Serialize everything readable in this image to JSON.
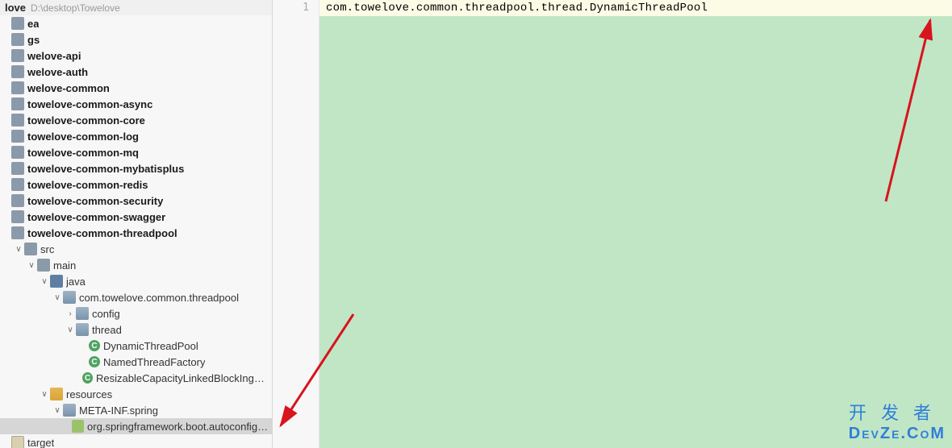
{
  "project": {
    "name": "love",
    "path": "D:\\desktop\\Towelove"
  },
  "tree": [
    {
      "indent": 0,
      "arrow": "",
      "icon": "folder",
      "label": "ea"
    },
    {
      "indent": 0,
      "arrow": "",
      "icon": "folder",
      "label": "gs"
    },
    {
      "indent": 0,
      "arrow": "",
      "icon": "folder",
      "label": "welove-api"
    },
    {
      "indent": 0,
      "arrow": "",
      "icon": "folder",
      "label": "welove-auth"
    },
    {
      "indent": 0,
      "arrow": "",
      "icon": "folder",
      "label": "welove-common"
    },
    {
      "indent": 0,
      "arrow": "",
      "icon": "folder",
      "label": "towelove-common-async"
    },
    {
      "indent": 0,
      "arrow": "",
      "icon": "folder",
      "label": "towelove-common-core"
    },
    {
      "indent": 0,
      "arrow": "",
      "icon": "folder",
      "label": "towelove-common-log"
    },
    {
      "indent": 0,
      "arrow": "",
      "icon": "folder",
      "label": "towelove-common-mq"
    },
    {
      "indent": 0,
      "arrow": "",
      "icon": "folder",
      "label": "towelove-common-mybatisplus"
    },
    {
      "indent": 0,
      "arrow": "",
      "icon": "folder",
      "label": "towelove-common-redis"
    },
    {
      "indent": 0,
      "arrow": "",
      "icon": "folder",
      "label": "towelove-common-security"
    },
    {
      "indent": 0,
      "arrow": "",
      "icon": "folder",
      "label": "towelove-common-swagger"
    },
    {
      "indent": 0,
      "arrow": "",
      "icon": "folder",
      "label": "towelove-common-threadpool"
    },
    {
      "indent": 1,
      "arrow": "v",
      "icon": "folder",
      "label": "src",
      "light": true
    },
    {
      "indent": 2,
      "arrow": "v",
      "icon": "folder",
      "label": "main",
      "light": true
    },
    {
      "indent": 3,
      "arrow": "v",
      "icon": "folder-b",
      "label": "java",
      "light": true
    },
    {
      "indent": 4,
      "arrow": "v",
      "icon": "pkg",
      "label": "com.towelove.common.threadpool",
      "light": true
    },
    {
      "indent": 5,
      "arrow": ">",
      "icon": "pkg",
      "label": "config",
      "light": true
    },
    {
      "indent": 5,
      "arrow": "v",
      "icon": "pkg",
      "label": "thread",
      "light": true
    },
    {
      "indent": 6,
      "arrow": "",
      "icon": "class",
      "label": "DynamicThreadPool",
      "light": true
    },
    {
      "indent": 6,
      "arrow": "",
      "icon": "class",
      "label": "NamedThreadFactory",
      "light": true
    },
    {
      "indent": 6,
      "arrow": "",
      "icon": "class",
      "label": "ResizableCapacityLinkedBlockIngQueue",
      "light": true
    },
    {
      "indent": 3,
      "arrow": "v",
      "icon": "pkg-res",
      "label": "resources",
      "light": true
    },
    {
      "indent": 4,
      "arrow": "v",
      "icon": "pkg",
      "label": "META-INF.spring",
      "light": true
    },
    {
      "indent": 5,
      "arrow": "",
      "icon": "file",
      "label": "org.springframework.boot.autoconfigure.A",
      "light": true,
      "selected": true
    },
    {
      "indent": 0,
      "arrow": "",
      "icon": "folder-o",
      "label": "target",
      "light": true
    }
  ],
  "editor": {
    "line_number": "1",
    "code": "com.towelove.common.threadpool.thread.DynamicThreadPool"
  },
  "watermark": {
    "line1": "开发者",
    "line2_a": "D",
    "line2_b": "EV",
    "line2_c": "Z",
    "line2_d": "E",
    "line2_e": ".C",
    "line2_f": "O",
    "line2_g": "M"
  }
}
